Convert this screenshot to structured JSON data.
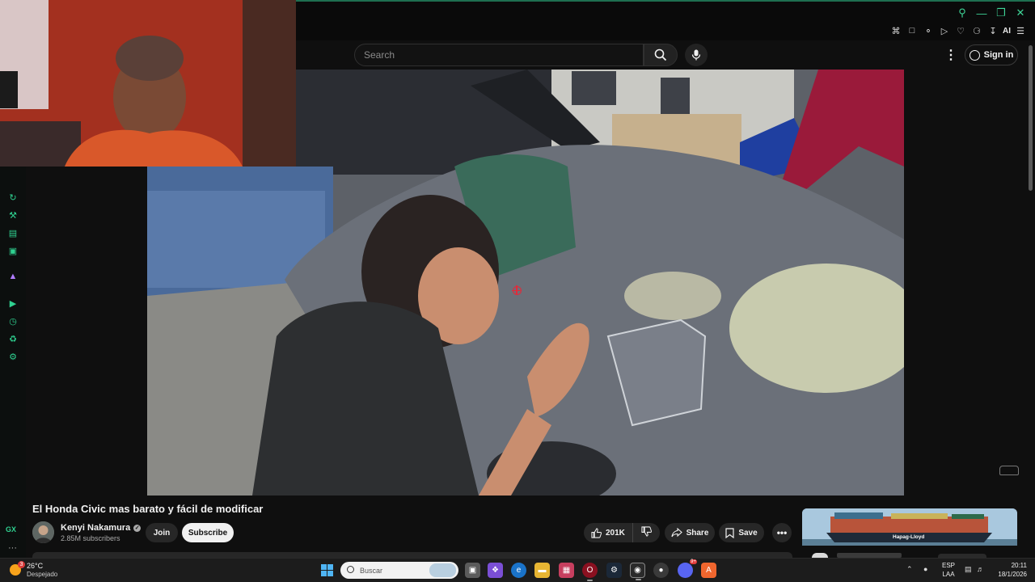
{
  "browser": {
    "toolbar_ai_label": "AI"
  },
  "youtube": {
    "search_placeholder": "Search",
    "sign_in_label": "Sign in",
    "video": {
      "title": "El Honda Civic mas barato y fácil de modificar",
      "channel_name": "Kenyi Nakamura",
      "subscribers": "2.85M subscribers",
      "join_label": "Join",
      "subscribe_label": "Subscribe",
      "likes": "201K",
      "share_label": "Share",
      "save_label": "Save"
    },
    "recommendation": {
      "thumb_label": "Hapag-Lloyd"
    }
  },
  "sidebar": {
    "gx_label": "GX",
    "more_label": "···"
  },
  "taskbar": {
    "weather_badge": "3",
    "temperature": "26°C",
    "condition": "Despejado",
    "search_placeholder": "Buscar",
    "notification_count": "9+",
    "lang_top": "ESP",
    "lang_bottom": "LAA",
    "time": "20:11",
    "date": "18/1/2026"
  }
}
